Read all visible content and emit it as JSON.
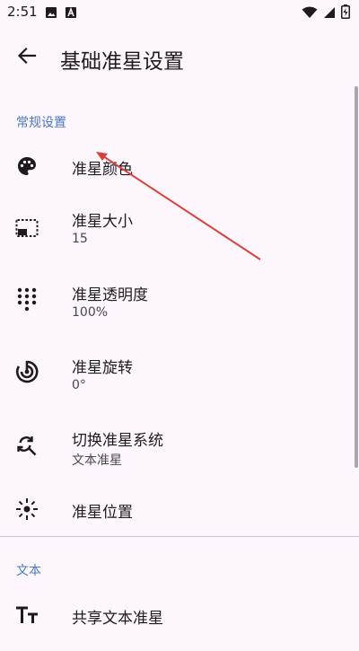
{
  "status_bar": {
    "time": "2:51",
    "left_icons": [
      "image-icon",
      "a-icon"
    ],
    "right_icons": [
      "wifi-icon",
      "signal-icon",
      "battery-icon"
    ]
  },
  "app_bar": {
    "title": "基础准星设置",
    "back_icon": "arrow-back-icon"
  },
  "sections": [
    {
      "header": "常规设置",
      "items": [
        {
          "title": "准星颜色",
          "summary": "",
          "icon": "palette-icon"
        },
        {
          "title": "准星大小",
          "summary": "15",
          "icon": "picture-in-picture-icon"
        },
        {
          "title": "准星透明度",
          "summary": "100%",
          "icon": "dots-grid-icon"
        },
        {
          "title": "准星旋转",
          "summary": "0°",
          "icon": "rotation-icon"
        },
        {
          "title": "切换准星系统",
          "summary": "文本准星",
          "icon": "find-replace-icon"
        },
        {
          "title": "准星位置",
          "summary": "",
          "icon": "center-focus-icon"
        }
      ]
    },
    {
      "header": "文本",
      "items": [
        {
          "title": "共享文本准星",
          "summary": "",
          "icon": "text-fields-icon"
        }
      ]
    }
  ],
  "colors": {
    "background": "#fdf7fd",
    "accent": "#4a78c2",
    "annotation_arrow": "#d9403a"
  }
}
